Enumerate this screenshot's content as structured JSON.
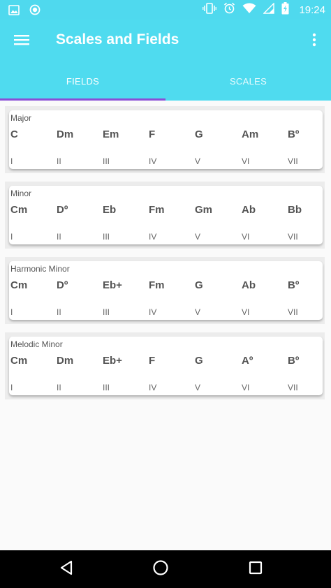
{
  "status_bar": {
    "time": "19:24",
    "icons_left": [
      "image-icon",
      "circle-notification-icon"
    ],
    "icons_right": [
      "vibrate-icon",
      "alarm-icon",
      "wifi-icon",
      "signal-icon",
      "battery-charging-icon"
    ]
  },
  "app_bar": {
    "title": "Scales and Fields",
    "menu_icon": "hamburger-menu-icon",
    "more_icon": "more-vert-icon"
  },
  "tabs": [
    {
      "label": "FIELDS",
      "selected": true
    },
    {
      "label": "SCALES",
      "selected": false
    }
  ],
  "fields": [
    {
      "name": "Major",
      "chords": [
        "C",
        "Dm",
        "Em",
        "F",
        "G",
        "Am",
        "Bº"
      ],
      "degrees": [
        "I",
        "II",
        "III",
        "IV",
        "V",
        "VI",
        "VII"
      ]
    },
    {
      "name": "Minor",
      "chords": [
        "Cm",
        "Dº",
        "Eb",
        "Fm",
        "Gm",
        "Ab",
        "Bb"
      ],
      "degrees": [
        "I",
        "II",
        "III",
        "IV",
        "V",
        "VI",
        "VII"
      ]
    },
    {
      "name": "Harmonic Minor",
      "chords": [
        "Cm",
        "Dº",
        "Eb+",
        "Fm",
        "G",
        "Ab",
        "Bº"
      ],
      "degrees": [
        "I",
        "II",
        "III",
        "IV",
        "V",
        "VI",
        "VII"
      ]
    },
    {
      "name": "Melodic Minor",
      "chords": [
        "Cm",
        "Dm",
        "Eb+",
        "F",
        "G",
        "Aº",
        "Bº"
      ],
      "degrees": [
        "I",
        "II",
        "III",
        "IV",
        "V",
        "VI",
        "VII"
      ]
    }
  ],
  "colors": {
    "primary": "#4fdbef",
    "tab_indicator": "#8a4fd6",
    "background": "#fafafa",
    "nav_bar": "#000000"
  },
  "nav_bar": {
    "icons": [
      "back-triangle-icon",
      "home-circle-icon",
      "recents-square-icon"
    ]
  }
}
